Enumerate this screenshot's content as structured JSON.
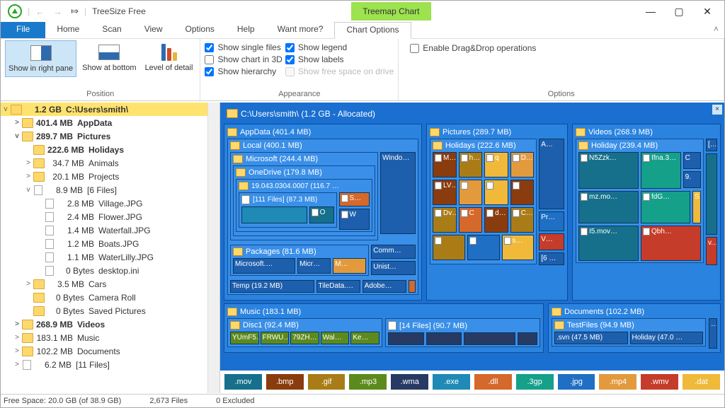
{
  "window": {
    "title": "TreeSize Free",
    "tab_highlight": "Treemap Chart",
    "min": "—",
    "max": "▢",
    "close": "✕"
  },
  "menu": {
    "file": "File",
    "items": [
      "Home",
      "Scan",
      "View",
      "Options",
      "Help",
      "Want more?"
    ],
    "active_tab": "Chart Options"
  },
  "ribbon": {
    "position": {
      "label": "Position",
      "show_right": "Show in right pane",
      "show_bottom": "Show at bottom",
      "level": "Level of detail"
    },
    "appearance": {
      "label": "Appearance",
      "single_files": "Show single files",
      "chart_3d": "Show chart in 3D",
      "hierarchy": "Show hierarchy",
      "legend": "Show legend",
      "labels": "Show labels",
      "free_space": "Show free space on drive"
    },
    "options": {
      "label": "Options",
      "dragdrop": "Enable Drag&Drop operations"
    }
  },
  "tree": {
    "root_size": "1.2 GB",
    "root_path": "C:\\Users\\smith\\",
    "items": [
      {
        "ind": 1,
        "exp": ">",
        "ico": "folder",
        "bold": true,
        "size": "401.4 MB",
        "name": "AppData"
      },
      {
        "ind": 1,
        "exp": "v",
        "ico": "folder",
        "bold": true,
        "size": "289.7 MB",
        "name": "Pictures"
      },
      {
        "ind": 2,
        "exp": "",
        "ico": "folder",
        "bold": true,
        "size": "222.6 MB",
        "name": "Holidays"
      },
      {
        "ind": 2,
        "exp": ">",
        "ico": "folder",
        "size": "34.7 MB",
        "name": "Animals"
      },
      {
        "ind": 2,
        "exp": ">",
        "ico": "folder",
        "size": "20.1 MB",
        "name": "Projects"
      },
      {
        "ind": 2,
        "exp": "v",
        "ico": "file",
        "size": "8.9 MB",
        "name": "[6 Files]"
      },
      {
        "ind": 3,
        "exp": "",
        "ico": "file",
        "size": "2.8 MB",
        "name": "Village.JPG"
      },
      {
        "ind": 3,
        "exp": "",
        "ico": "file",
        "size": "2.4 MB",
        "name": "Flower.JPG"
      },
      {
        "ind": 3,
        "exp": "",
        "ico": "file",
        "size": "1.4 MB",
        "name": "Waterfall.JPG"
      },
      {
        "ind": 3,
        "exp": "",
        "ico": "file",
        "size": "1.2 MB",
        "name": "Boats.JPG"
      },
      {
        "ind": 3,
        "exp": "",
        "ico": "file",
        "size": "1.1 MB",
        "name": "WaterLilly.JPG"
      },
      {
        "ind": 3,
        "exp": "",
        "ico": "file",
        "size": "0 Bytes",
        "name": "desktop.ini"
      },
      {
        "ind": 2,
        "exp": ">",
        "ico": "folder",
        "size": "3.5 MB",
        "name": "Cars"
      },
      {
        "ind": 2,
        "exp": "",
        "ico": "folder",
        "size": "0 Bytes",
        "name": "Camera Roll"
      },
      {
        "ind": 2,
        "exp": "",
        "ico": "folder",
        "size": "0 Bytes",
        "name": "Saved Pictures"
      },
      {
        "ind": 1,
        "exp": ">",
        "ico": "folder",
        "bold": true,
        "size": "268.9 MB",
        "name": "Videos"
      },
      {
        "ind": 1,
        "exp": ">",
        "ico": "folder",
        "size": "183.1 MB",
        "name": "Music"
      },
      {
        "ind": 1,
        "exp": ">",
        "ico": "folder",
        "size": "102.2 MB",
        "name": "Documents"
      },
      {
        "ind": 1,
        "exp": ">",
        "ico": "file",
        "size": "6.2 MB",
        "name": "[11 Files]"
      }
    ]
  },
  "chart": {
    "path": "C:\\Users\\smith\\ (1.2 GB - Allocated)",
    "appdata": {
      "label": "AppData (401.4 MB)",
      "local": "Local (400.1 MB)",
      "microsoft": "Microsoft (244.4 MB)",
      "onedrive": "OneDrive (179.8 MB)",
      "build": "19.043.0304.0007 (116.7 …",
      "files111": "[111 Files] (87.3 MB)",
      "s": "S…",
      "w": "W",
      "o": "O",
      "windo": "Windo…",
      "packages": "Packages (81.6 MB)",
      "ms1": "Microsoft.…",
      "ms2": "Micr…",
      "m": "M…",
      "comm": "Comm…",
      "unist": "Unist…",
      "temp": "Temp (19.2 MB)",
      "tiledata": "TileData.…",
      "adobe": "Adobe…"
    },
    "pictures": {
      "label": "Pictures (289.7 MB)",
      "holidays": "Holidays (222.6 MB)",
      "a": "A…",
      "tiles": [
        "M…",
        "h…",
        "q",
        "D…",
        "LV…",
        "",
        "",
        "",
        "Dv…",
        "C",
        "d…",
        "C…",
        "",
        "",
        "s…"
      ],
      "pr": "Pr…",
      "v": "V…",
      "six": "[6 …"
    },
    "videos": {
      "label": "Videos (268.9 MB)",
      "holiday": "Holiday (239.4 MB)",
      "tl": "[…",
      "n5": "N5Zzk…",
      "ifna": "Ifna.3…",
      "c": "C",
      "nine": "9.",
      "mz": "mz.mo…",
      "fdg": "fdG…",
      "s": "S",
      "i5": "I5.mov…",
      "qbh": "Qbh…",
      "v": "v.…"
    },
    "music": {
      "label": "Music (183.1 MB)",
      "disc1": "Disc1 (92.4 MB)",
      "bars": [
        "YUmF5…",
        "FRWU…",
        "79ZH…",
        "Wal…",
        "Ke…"
      ],
      "files14": "[14 Files] (90.7 MB)"
    },
    "documents": {
      "label": "Documents (102.2 MB)",
      "test": "TestFiles (94.9 MB)",
      "svn": ".svn (47.5 MB)",
      "holiday": "Holiday (47.0 …",
      "dots": "…"
    }
  },
  "exts": [
    {
      "c": "c-mov",
      "t": ".mov"
    },
    {
      "c": "c-bmp",
      "t": ".bmp"
    },
    {
      "c": "c-gif",
      "t": ".gif"
    },
    {
      "c": "c-mp3",
      "t": ".mp3"
    },
    {
      "c": "c-wma",
      "t": ".wma"
    },
    {
      "c": "c-exe",
      "t": ".exe"
    },
    {
      "c": "c-dll",
      "t": ".dll"
    },
    {
      "c": "c-3gp",
      "t": ".3gp"
    },
    {
      "c": "c-jpg",
      "t": ".jpg"
    },
    {
      "c": "c-mp4",
      "t": ".mp4"
    },
    {
      "c": "c-wmv",
      "t": ".wmv"
    },
    {
      "c": "c-dat",
      "t": ".dat"
    }
  ],
  "status": {
    "free": "Free Space: 20.0 GB  (of 38.9 GB)",
    "files": "2,673 Files",
    "excluded": "0 Excluded"
  },
  "chart_data": {
    "type": "treemap",
    "unit": "MB",
    "root": {
      "name": "C:\\Users\\smith\\",
      "size": 1228.8
    },
    "children": [
      {
        "name": "AppData",
        "size": 401.4,
        "children": [
          {
            "name": "Local",
            "size": 400.1,
            "children": [
              {
                "name": "Microsoft",
                "size": 244.4,
                "children": [
                  {
                    "name": "OneDrive",
                    "size": 179.8,
                    "children": [
                      {
                        "name": "19.043.0304.0007",
                        "size": 116.7,
                        "children": [
                          {
                            "name": "[111 Files]",
                            "size": 87.3
                          }
                        ]
                      }
                    ]
                  }
                ]
              },
              {
                "name": "Packages",
                "size": 81.6
              },
              {
                "name": "Temp",
                "size": 19.2
              }
            ]
          }
        ]
      },
      {
        "name": "Pictures",
        "size": 289.7,
        "children": [
          {
            "name": "Holidays",
            "size": 222.6
          },
          {
            "name": "Animals",
            "size": 34.7
          },
          {
            "name": "Projects",
            "size": 20.1
          },
          {
            "name": "[6 Files]",
            "size": 8.9
          },
          {
            "name": "Cars",
            "size": 3.5
          },
          {
            "name": "Camera Roll",
            "size": 0
          },
          {
            "name": "Saved Pictures",
            "size": 0
          }
        ]
      },
      {
        "name": "Videos",
        "size": 268.9,
        "children": [
          {
            "name": "Holiday",
            "size": 239.4
          }
        ]
      },
      {
        "name": "Music",
        "size": 183.1,
        "children": [
          {
            "name": "Disc1",
            "size": 92.4
          },
          {
            "name": "[14 Files]",
            "size": 90.7
          }
        ]
      },
      {
        "name": "Documents",
        "size": 102.2,
        "children": [
          {
            "name": "TestFiles",
            "size": 94.9,
            "children": [
              {
                "name": ".svn",
                "size": 47.5
              },
              {
                "name": "Holiday",
                "size": 47.0
              }
            ]
          }
        ]
      },
      {
        "name": "[11 Files]",
        "size": 6.2
      }
    ]
  }
}
